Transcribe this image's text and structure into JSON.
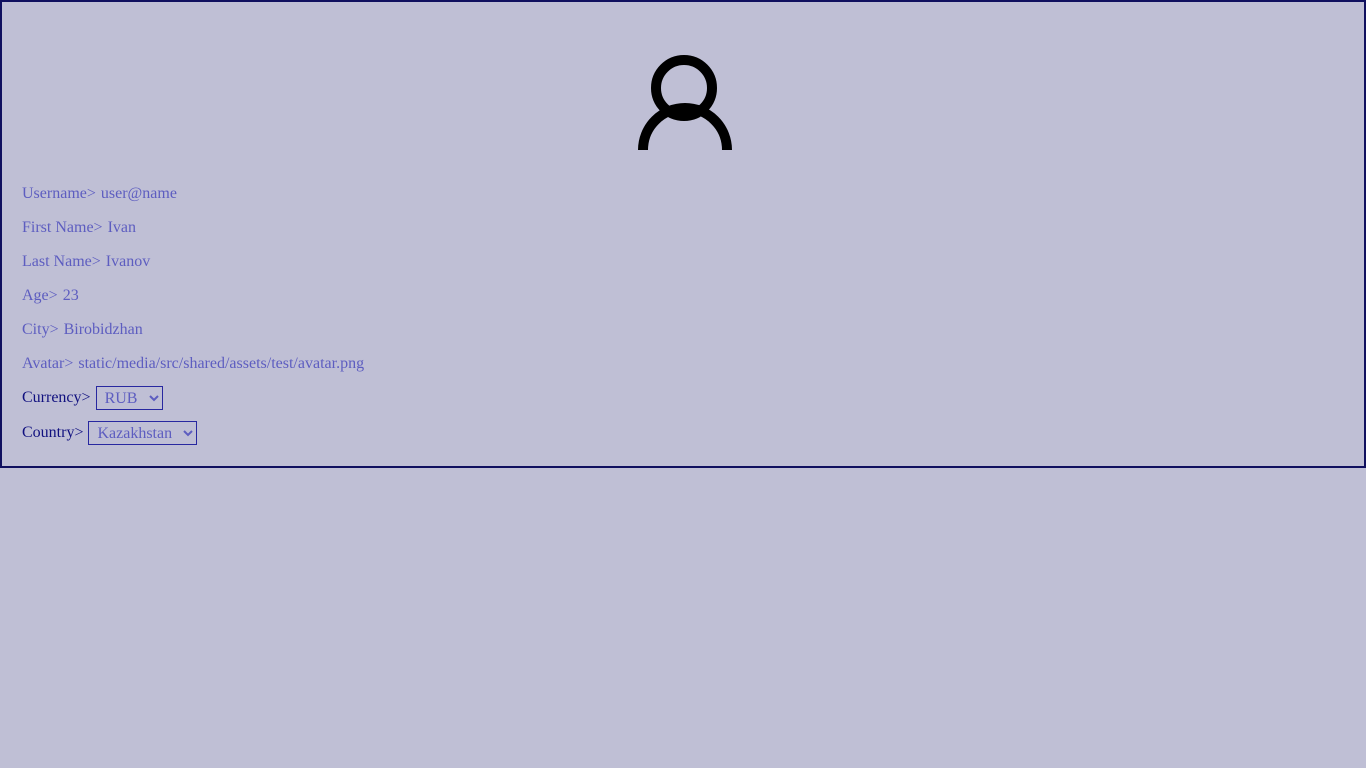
{
  "profile": {
    "avatar_icon": "user-avatar-icon",
    "fields": {
      "username": {
        "label": "Username>",
        "value": "user@name"
      },
      "first_name": {
        "label": "First Name>",
        "value": "Ivan"
      },
      "last_name": {
        "label": "Last Name>",
        "value": "Ivanov"
      },
      "age": {
        "label": "Age>",
        "value": "23"
      },
      "city": {
        "label": "City>",
        "value": "Birobidzhan"
      },
      "avatar": {
        "label": "Avatar>",
        "value": "static/media/src/shared/assets/test/avatar.png"
      }
    },
    "currency": {
      "label": "Currency>",
      "selected": "RUB"
    },
    "country": {
      "label": "Country>",
      "selected": "Kazakhstan"
    }
  },
  "colors": {
    "background": "#bfbfd5",
    "border": "#10105f",
    "text": "#5d5dc0",
    "label_dark": "#10107f"
  }
}
